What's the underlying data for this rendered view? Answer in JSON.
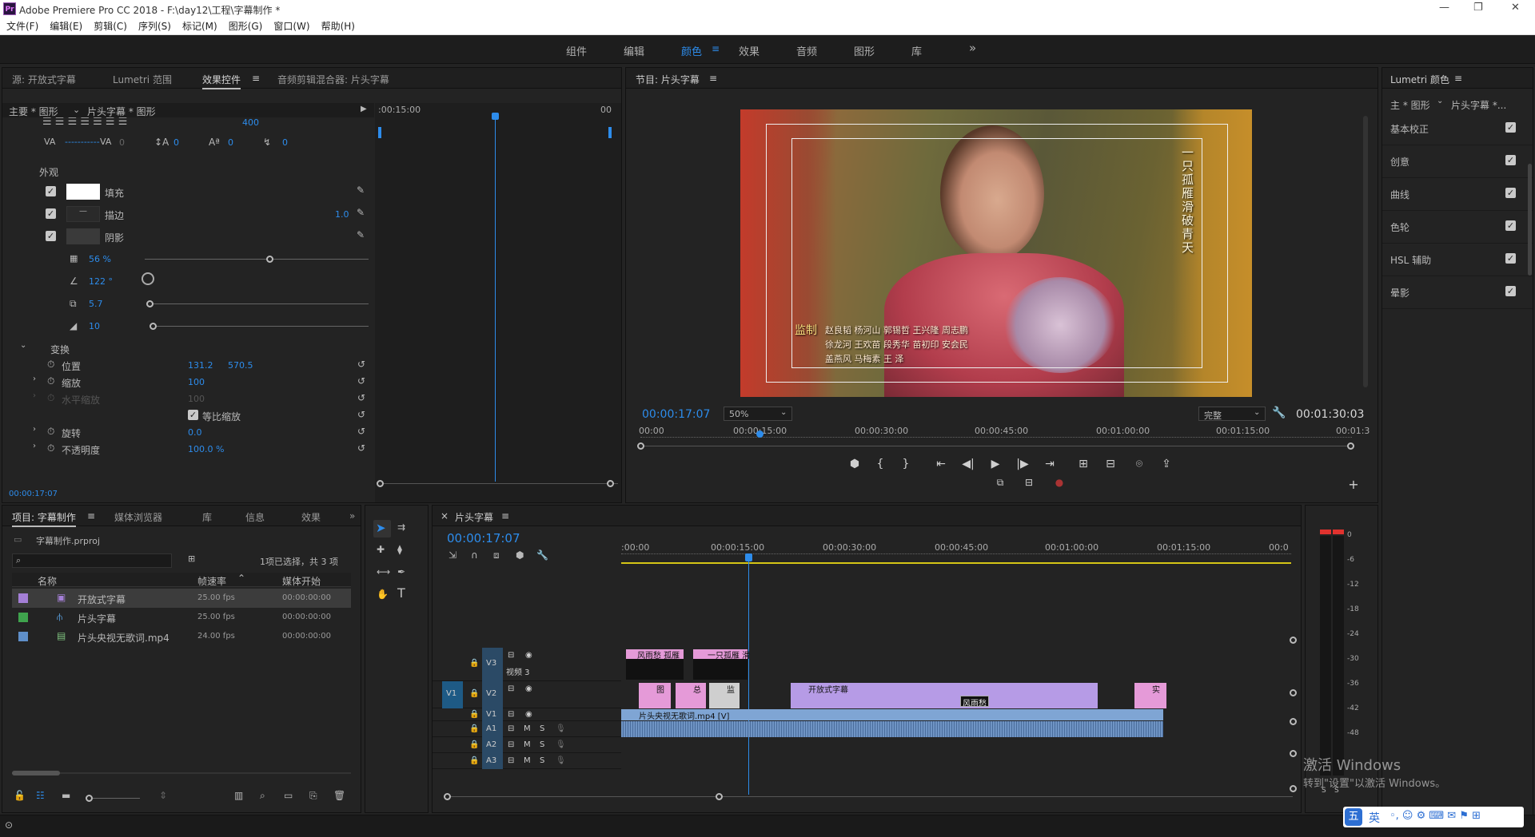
{
  "window": {
    "title": "Adobe Premiere Pro CC 2018 - F:\\day12\\工程\\字幕制作 *",
    "app_icon": "Pr",
    "controls": [
      "—",
      "❐",
      "✕"
    ]
  },
  "menu": [
    "文件(F)",
    "编辑(E)",
    "剪辑(C)",
    "序列(S)",
    "标记(M)",
    "图形(G)",
    "窗口(W)",
    "帮助(H)"
  ],
  "workspaces": {
    "items": [
      "组件",
      "编辑",
      "颜色",
      "效果",
      "音频",
      "图形",
      "库"
    ],
    "active": "颜色",
    "more": "»"
  },
  "source_panel": {
    "tabs": [
      "源: 开放式字幕",
      "Lumetri 范围",
      "效果控件",
      "音频剪辑混合器: 片头字幕"
    ],
    "active_tab": "效果控件",
    "master": "主要 * 图形",
    "clip": "片头字幕 * 图形",
    "ruler_time": ":00:15:00",
    "ruler_end": "00",
    "text_props": {
      "size": "400",
      "tracking": "0",
      "kerning": "0",
      "leading": "0",
      "baseline": "0"
    },
    "appearance_label": "外观",
    "fill_label": "填充",
    "stroke_label": "描边",
    "stroke_value": "1.0",
    "shadow_label": "阴影",
    "shadow_opacity": "56 %",
    "shadow_angle": "122 °",
    "shadow_distance": "5.7",
    "shadow_size": "10",
    "shadow_opacity_pct": 56,
    "transform_label": "变换",
    "position_label": "位置",
    "position_x": "131.2",
    "position_y": "570.5",
    "scale_label": "缩放",
    "scale_value": "100",
    "scale_w_label": "水平缩放",
    "scale_w_value": "100",
    "uniform_label": "等比缩放",
    "rotation_label": "旋转",
    "rotation_value": "0.0",
    "opacity_label": "不透明度",
    "opacity_value": "100.0 %",
    "timecode": "00:00:17:07"
  },
  "program": {
    "title": "节目: 片头字幕",
    "timecode": "00:00:17:07",
    "zoom": "50%",
    "quality": "完整",
    "duration": "00:01:30:03",
    "ruler": [
      "00:00",
      "00:00:15:00",
      "00:00:30:00",
      "00:00:45:00",
      "00:01:00:00",
      "00:01:15:00",
      "00:01:3"
    ],
    "vertical_title": "一只孤雁  滑破青天",
    "credit_label": "监制",
    "credit_lines": [
      "赵良韬 杨河山 郭锡哲 王兴隆 周志鹏",
      "徐龙河 王欢苗 段秀华 苗初印 安会民",
      "盖燕风 马梅素 王 泽"
    ],
    "controls": [
      "⬢",
      "{",
      "}",
      "⇤",
      "◀|",
      "▶",
      "|▶",
      "⇥",
      "⊞",
      "⊟",
      "⌾",
      "⇪"
    ],
    "add": "+"
  },
  "lumetri": {
    "title": "Lumetri 颜色",
    "master": "主 * 图形",
    "clip": "片头字幕 *...",
    "sections": [
      "基本校正",
      "创意",
      "曲线",
      "色轮",
      "HSL 辅助",
      "晕影"
    ]
  },
  "project": {
    "tabs": [
      "项目: 字幕制作",
      "媒体浏览器",
      "库",
      "信息",
      "效果"
    ],
    "file": "字幕制作.prproj",
    "selection": "1项已选择，共 3 项",
    "columns": [
      "名称",
      "帧速率",
      "媒体开始"
    ],
    "rows": [
      {
        "name": "开放式字幕",
        "fps": "25.00 fps",
        "start": "00:00:00:00",
        "color": "#a47fd6"
      },
      {
        "name": "片头字幕",
        "fps": "25.00 fps",
        "start": "00:00:00:00",
        "color": "#3fa34d"
      },
      {
        "name": "片头央视无歌词.mp4",
        "fps": "24.00 fps",
        "start": "00:00:00:00",
        "color": "#5f8fc9"
      }
    ]
  },
  "timeline": {
    "tab": "片头字幕",
    "timecode": "00:00:17:07",
    "ruler": [
      ":00:00",
      "00:00:15:00",
      "00:00:30:00",
      "00:00:45:00",
      "00:01:00:00",
      "00:01:15:00",
      "00:0"
    ],
    "tracks": [
      {
        "id": "V3",
        "name": "视频 3"
      },
      {
        "id": "V2",
        "name": ""
      },
      {
        "id": "V1",
        "name": ""
      },
      {
        "id": "A1",
        "name": ""
      },
      {
        "id": "A2",
        "name": ""
      },
      {
        "id": "A3",
        "name": ""
      }
    ],
    "source_patch": "V1",
    "clips": {
      "v3a": "风雨愁 孤雁",
      "v3b": "一只孤雁 滑",
      "v2a": "图",
      "v2b": "总",
      "v2c": "监",
      "v2d": "开放式字幕",
      "v2e": "风雨愁",
      "v2f": "实",
      "v1": "片头央视无歌词.mp4 [V]"
    },
    "track_btn_m": "M",
    "track_btn_s": "S"
  },
  "meter": {
    "scale": [
      "0",
      "-6",
      "-12",
      "-18",
      "-24",
      "-30",
      "-36",
      "-42",
      "-48"
    ],
    "solo": "S"
  },
  "watermark": {
    "line1": "激活 Windows",
    "line2": "转到\"设置\"以激活 Windows。"
  },
  "ime": {
    "label": "英"
  }
}
